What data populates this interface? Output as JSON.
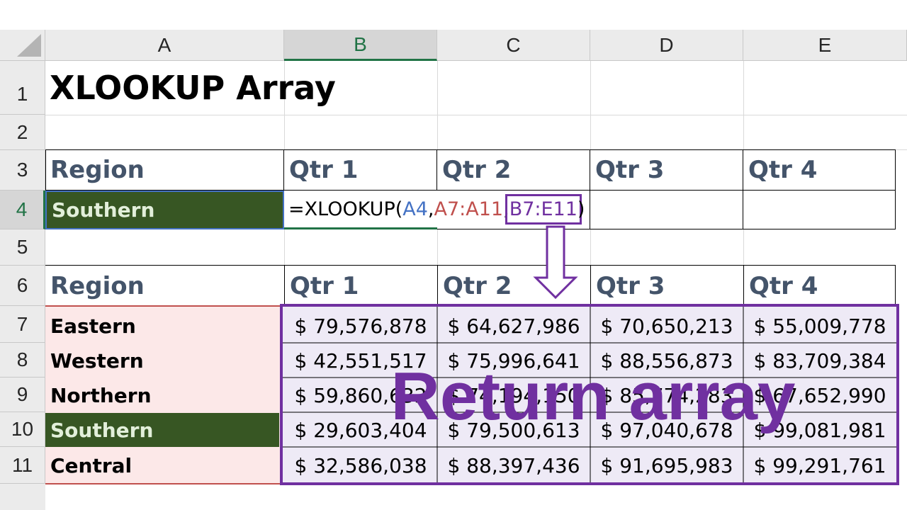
{
  "columns": [
    "A",
    "B",
    "C",
    "D",
    "E"
  ],
  "rows": [
    "1",
    "2",
    "3",
    "4",
    "5",
    "6",
    "7",
    "8",
    "9",
    "10",
    "11"
  ],
  "title": "XLOOKUP Array",
  "lookup_header": [
    "Region",
    "Qtr 1",
    "Qtr 2",
    "Qtr 3",
    "Qtr 4"
  ],
  "lookup_value": "Southern",
  "formula": {
    "prefix": "=XLOOKUP(",
    "arg1": "A4",
    "comma1": ",",
    "arg2": "A7:A11",
    "comma2": ",",
    "arg3": "B7:E11",
    "suffix": ")"
  },
  "table_header": [
    "Region",
    "Qtr 1",
    "Qtr 2",
    "Qtr 3",
    "Qtr 4"
  ],
  "table_rows": [
    {
      "region": "Eastern",
      "values": [
        "$ 79,576,878",
        "$ 64,627,986",
        "$ 70,650,213",
        "$ 55,009,778"
      ]
    },
    {
      "region": "Western",
      "values": [
        "$ 42,551,517",
        "$ 75,996,641",
        "$ 88,556,873",
        "$ 83,709,384"
      ]
    },
    {
      "region": "Northern",
      "values": [
        "$ 59,860,632",
        "$ 74,194,150",
        "$ 85,774,283",
        "$ 67,652,990"
      ]
    },
    {
      "region": "Southern",
      "values": [
        "$ 29,603,404",
        "$ 79,500,613",
        "$ 97,040,678",
        "$ 99,081,981"
      ]
    },
    {
      "region": "Central",
      "values": [
        "$ 32,586,038",
        "$ 88,397,436",
        "$ 91,695,983",
        "$ 99,291,761"
      ]
    }
  ],
  "annotation": "Return array",
  "colors": {
    "arg1": "#4472c4",
    "arg2": "#c0504d",
    "arg3": "#7030a0",
    "highlight_fill": "#375623",
    "highlight_text": "#e2efda",
    "lookup_col_fill": "#fce8e8",
    "return_fill": "#eeeaf6",
    "header_text": "#44546a"
  }
}
